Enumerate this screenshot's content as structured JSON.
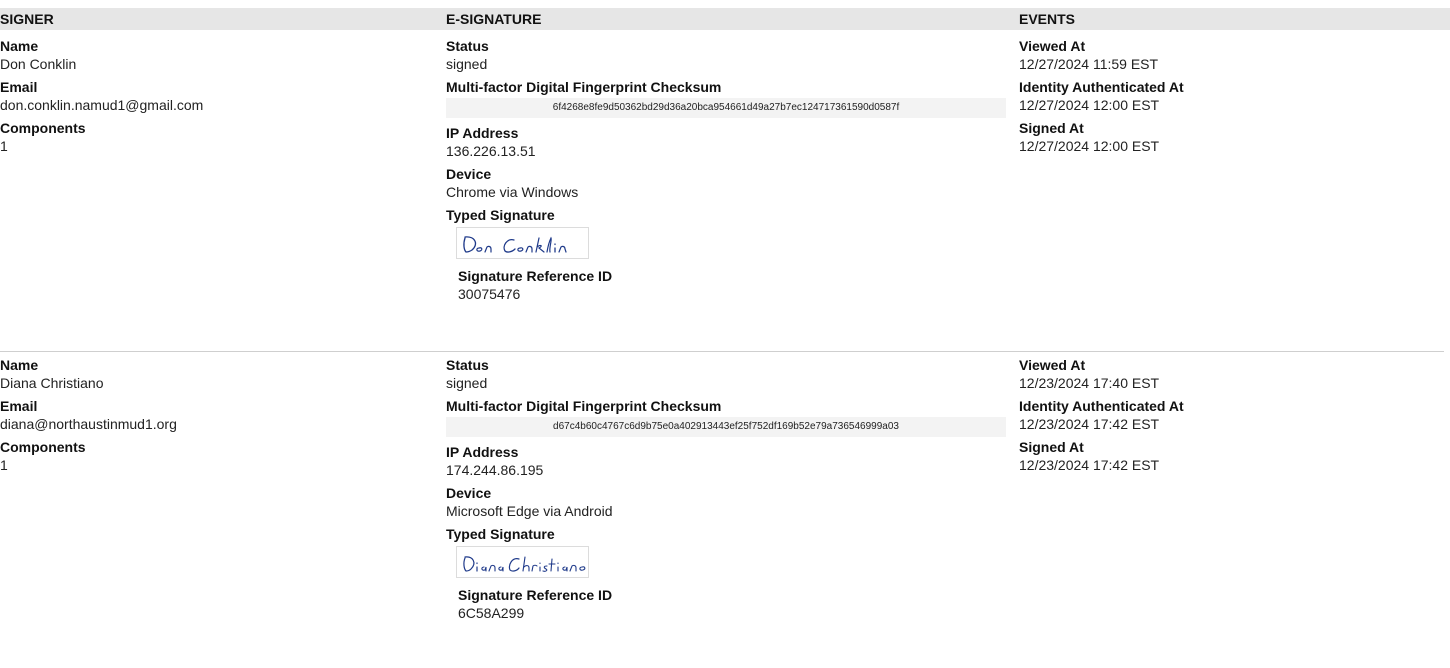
{
  "headers": {
    "signer": "SIGNER",
    "esignature": "E-SIGNATURE",
    "events": "EVENTS"
  },
  "labels": {
    "name": "Name",
    "email": "Email",
    "components": "Components",
    "status": "Status",
    "checksum": "Multi-factor Digital Fingerprint Checksum",
    "ip": "IP Address",
    "device": "Device",
    "typed_signature": "Typed Signature",
    "sig_ref": "Signature Reference ID",
    "viewed_at": "Viewed At",
    "identity_authenticated_at": "Identity Authenticated At",
    "signed_at": "Signed At"
  },
  "signers": [
    {
      "name": "Don Conklin",
      "email": "don.conklin.namud1@gmail.com",
      "components": "1",
      "status": "signed",
      "checksum": "6f4268e8fe9d50362bd29d36a20bca954661d49a27b7ec124717361590d0587f",
      "ip": "136.226.13.51",
      "device": "Chrome via Windows",
      "typed_signature": "Don Conklin",
      "sig_ref": "30075476",
      "viewed_at": "12/27/2024 11:59 EST",
      "identity_authenticated_at": "12/27/2024 12:00 EST",
      "signed_at": "12/27/2024 12:00 EST"
    },
    {
      "name": "Diana Christiano",
      "email": "diana@northaustinmud1.org",
      "components": "1",
      "status": "signed",
      "checksum": "d67c4b60c4767c6d9b75e0a402913443ef25f752df169b52e79a736546999a03",
      "ip": "174.244.86.195",
      "device": "Microsoft Edge via Android",
      "typed_signature": "Diana Christiano",
      "sig_ref": "6C58A299",
      "viewed_at": "12/23/2024 17:40 EST",
      "identity_authenticated_at": "12/23/2024 17:42 EST",
      "signed_at": "12/23/2024 17:42 EST"
    }
  ],
  "colors": {
    "header_bg": "#e6e6e6",
    "signature_ink": "#1f3a8a"
  }
}
